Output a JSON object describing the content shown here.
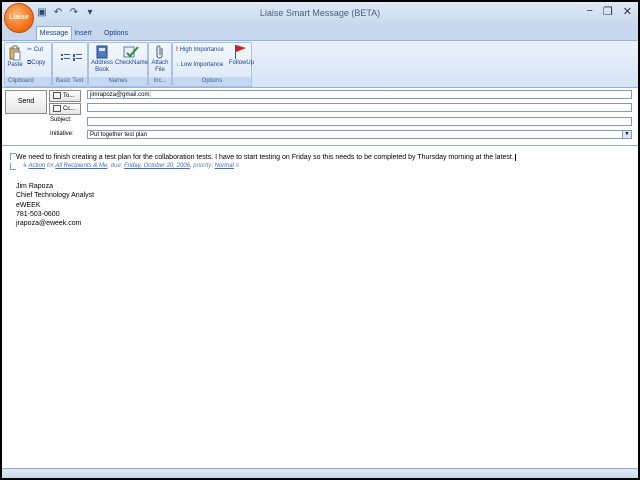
{
  "app": {
    "logo_text": "Liaise",
    "title": "Liaise Smart Message   (BETA)"
  },
  "window_controls": {
    "minimize": "−",
    "restore": "❐",
    "close": "✕"
  },
  "quick_access": {
    "save": "▣",
    "undo": "↶",
    "redo": "↷",
    "customize": "▾"
  },
  "tabs": [
    {
      "label": "Message",
      "active": true
    },
    {
      "label": "Insert",
      "active": false
    },
    {
      "label": "Options",
      "active": false
    }
  ],
  "ribbon": {
    "clipboard": {
      "label": "Clipboard",
      "paste": "Paste",
      "cut": "Cut",
      "copy": "Copy"
    },
    "basic_text": {
      "label": "Basic Text"
    },
    "names": {
      "label": "Names",
      "address_book_1": "Address",
      "address_book_2": "Book",
      "check_names": "CheckNames"
    },
    "include": {
      "label": "Inc...",
      "attach_1": "Attach",
      "attach_2": "File"
    },
    "options": {
      "label": "Options",
      "high_importance": "High Importance",
      "low_importance": "Low Importance",
      "follow_up": "FollowUp"
    }
  },
  "header": {
    "send": "Send",
    "to_button": "To...",
    "cc_button": "Cc...",
    "subject_label": "Subject:",
    "initiative_label": "Initiative:",
    "to_value": "jimrapoza@gmail.com;",
    "cc_value": "",
    "subject_value": "",
    "initiative_value": "Put together test plan"
  },
  "body": {
    "text": "We need to finish creating a test plan for the collaboration tests. I have to start testing on Friday so this needs to be completed by Thursday morning at the latest.",
    "meta": {
      "action": "Action",
      "for": " for ",
      "recipients": "All Recipients & Me",
      "due": ", due: ",
      "date": "Friday, October 20, 2006",
      "priority": ", priority: ",
      "priority_value": "Normal",
      "extra": "  ≡"
    },
    "signature": [
      "Jim Rapoza",
      "Chief Technology Analyst",
      "eWEEK",
      "781-503-0600",
      "jrapoza@eweek.com"
    ]
  }
}
